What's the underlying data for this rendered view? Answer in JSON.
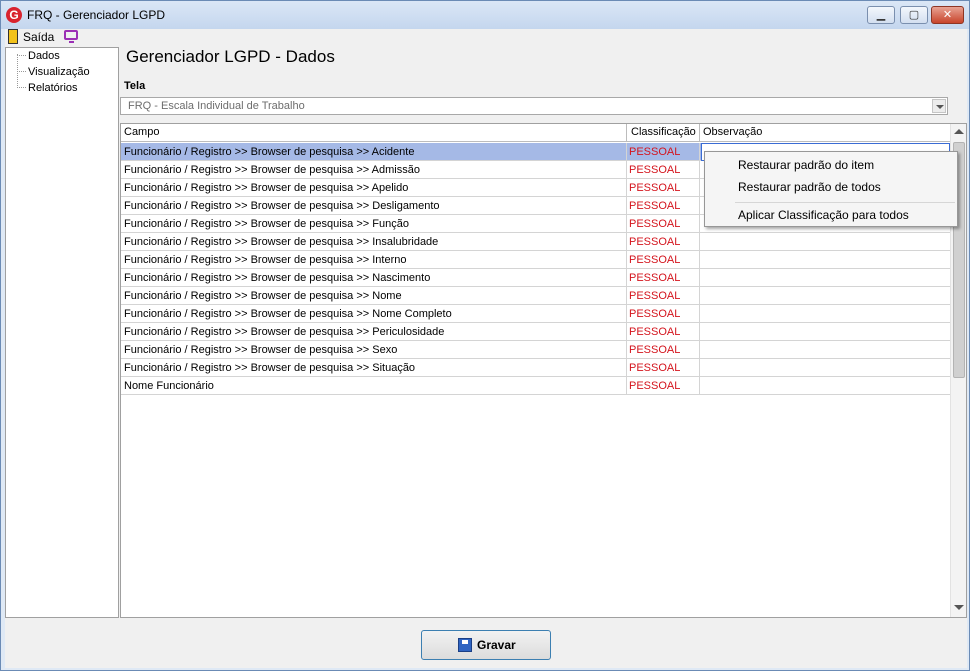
{
  "window": {
    "title": "FRQ - Gerenciador LGPD",
    "app_icon": "G"
  },
  "menu": {
    "exit_label": "Saída"
  },
  "tree": {
    "items": [
      "Dados",
      "Visualização",
      "Relatórios"
    ]
  },
  "heading": "Gerenciador LGPD - Dados",
  "tela": {
    "label": "Tela",
    "value": "FRQ - Escala Individual de Trabalho"
  },
  "grid": {
    "columns": [
      "Campo",
      "Classificação",
      "Observação"
    ],
    "rows": [
      {
        "campo": "Funcionário / Registro >> Browser de pesquisa >> Acidente",
        "classificacao": "PESSOAL",
        "observacao": ""
      },
      {
        "campo": "Funcionário / Registro >> Browser de pesquisa >> Admissão",
        "classificacao": "PESSOAL",
        "observacao": ""
      },
      {
        "campo": "Funcionário / Registro >> Browser de pesquisa >> Apelido",
        "classificacao": "PESSOAL",
        "observacao": ""
      },
      {
        "campo": "Funcionário / Registro >> Browser de pesquisa >> Desligamento",
        "classificacao": "PESSOAL",
        "observacao": ""
      },
      {
        "campo": "Funcionário / Registro >> Browser de pesquisa >> Função",
        "classificacao": "PESSOAL",
        "observacao": ""
      },
      {
        "campo": "Funcionário / Registro >> Browser de pesquisa >> Insalubridade",
        "classificacao": "PESSOAL",
        "observacao": ""
      },
      {
        "campo": "Funcionário / Registro >> Browser de pesquisa >> Interno",
        "classificacao": "PESSOAL",
        "observacao": ""
      },
      {
        "campo": "Funcionário / Registro >> Browser de pesquisa >> Nascimento",
        "classificacao": "PESSOAL",
        "observacao": ""
      },
      {
        "campo": "Funcionário / Registro >> Browser de pesquisa >> Nome",
        "classificacao": "PESSOAL",
        "observacao": ""
      },
      {
        "campo": "Funcionário / Registro >> Browser de pesquisa >> Nome Completo",
        "classificacao": "PESSOAL",
        "observacao": ""
      },
      {
        "campo": "Funcionário / Registro >> Browser de pesquisa >> Periculosidade",
        "classificacao": "PESSOAL",
        "observacao": ""
      },
      {
        "campo": "Funcionário / Registro >> Browser de pesquisa >> Sexo",
        "classificacao": "PESSOAL",
        "observacao": ""
      },
      {
        "campo": "Funcionário / Registro >> Browser de pesquisa >> Situação",
        "classificacao": "PESSOAL",
        "observacao": ""
      },
      {
        "campo": "Nome Funcionário",
        "classificacao": "PESSOAL",
        "observacao": ""
      }
    ],
    "selected_row": 0
  },
  "context_menu": {
    "items": [
      "Restaurar padrão do item",
      "Restaurar padrão de todos",
      "Aplicar Classificação para todos"
    ]
  },
  "save_button": {
    "label": "Gravar",
    "icon": "floppy-disk-icon"
  },
  "colors": {
    "classification_text": "#d4141d",
    "selected_row": "#a5b9e6",
    "save_border": "#3c7fb1"
  }
}
